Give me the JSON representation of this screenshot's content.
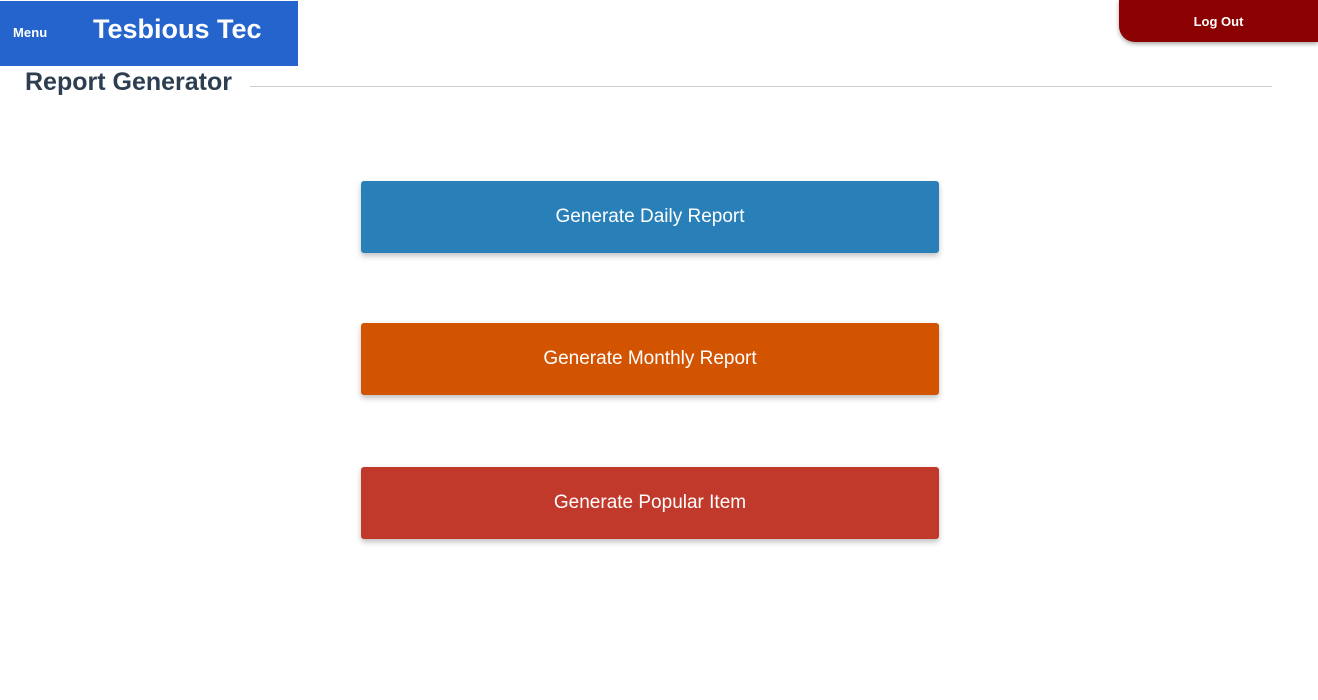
{
  "header": {
    "menu_label": "Menu",
    "brand": "Tesbious Tec",
    "logout_label": "Log Out"
  },
  "page": {
    "title": "Report Generator"
  },
  "actions": [
    {
      "label": "Generate Daily Report",
      "color": "#2980b9"
    },
    {
      "label": "Generate Monthly Report",
      "color": "#d35400"
    },
    {
      "label": "Generate Popular Item",
      "color": "#c0392b"
    }
  ],
  "colors": {
    "brand_bar": "#2464cc",
    "logout": "#8b0000",
    "title_text": "#2c3e50"
  }
}
